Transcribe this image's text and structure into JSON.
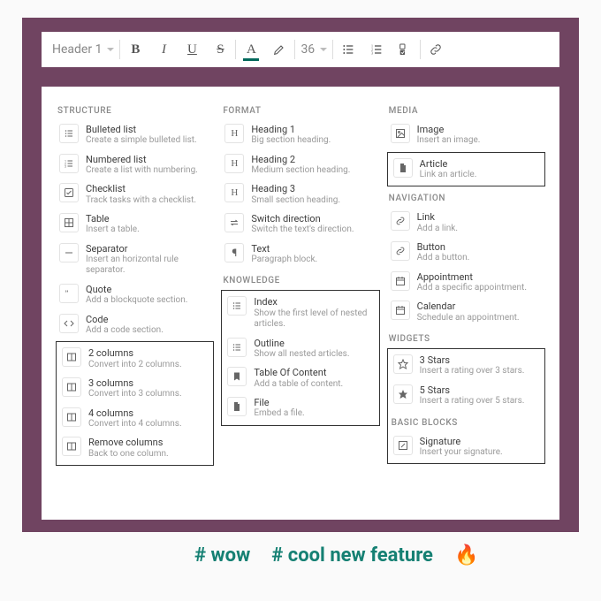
{
  "toolbar": {
    "style_select": "Header 1",
    "bold": "B",
    "italic": "I",
    "underline": "U",
    "strike": "S",
    "fontcolor": "A",
    "fontsize": "36"
  },
  "panel": {
    "columns": [
      {
        "groups": [
          {
            "label": "STRUCTURE",
            "highlight": false,
            "items": [
              {
                "icon": "list-ul",
                "title": "Bulleted list",
                "desc": "Create a simple bulleted list."
              },
              {
                "icon": "list-ol",
                "title": "Numbered list",
                "desc": "Create a list with numbering."
              },
              {
                "icon": "check",
                "title": "Checklist",
                "desc": "Track tasks with a checklist."
              },
              {
                "icon": "table",
                "title": "Table",
                "desc": "Insert a table."
              },
              {
                "icon": "minus",
                "title": "Separator",
                "desc": "Insert an horizontal rule separator."
              },
              {
                "icon": "quote",
                "title": "Quote",
                "desc": "Add a blockquote section."
              },
              {
                "icon": "code",
                "title": "Code",
                "desc": "Add a code section."
              }
            ]
          },
          {
            "label": "",
            "highlight": true,
            "items": [
              {
                "icon": "cols",
                "title": "2 columns",
                "desc": "Convert into 2 columns."
              },
              {
                "icon": "cols",
                "title": "3 columns",
                "desc": "Convert into 3 columns."
              },
              {
                "icon": "cols",
                "title": "4 columns",
                "desc": "Convert into 4 columns."
              },
              {
                "icon": "cols",
                "title": "Remove columns",
                "desc": "Back to one column."
              }
            ]
          }
        ]
      },
      {
        "groups": [
          {
            "label": "FORMAT",
            "highlight": false,
            "items": [
              {
                "icon": "H",
                "title": "Heading 1",
                "desc": "Big section heading."
              },
              {
                "icon": "H",
                "title": "Heading 2",
                "desc": "Medium section heading."
              },
              {
                "icon": "H",
                "title": "Heading 3",
                "desc": "Small section heading."
              },
              {
                "icon": "swap",
                "title": "Switch direction",
                "desc": "Switch the text's direction."
              },
              {
                "icon": "para",
                "title": "Text",
                "desc": "Paragraph block."
              }
            ]
          },
          {
            "label": "KNOWLEDGE",
            "highlight": true,
            "items": [
              {
                "icon": "list-ul",
                "title": "Index",
                "desc": "Show the first level of nested articles."
              },
              {
                "icon": "list-ul",
                "title": "Outline",
                "desc": "Show all nested articles."
              },
              {
                "icon": "bookmark",
                "title": "Table Of Content",
                "desc": "Add a table of content."
              },
              {
                "icon": "file",
                "title": "File",
                "desc": "Embed a file."
              }
            ]
          }
        ]
      },
      {
        "groups": [
          {
            "label": "MEDIA",
            "highlight": false,
            "items": [
              {
                "icon": "image",
                "title": "Image",
                "desc": "Insert an image."
              }
            ]
          },
          {
            "label": "",
            "highlight": true,
            "items": [
              {
                "icon": "file",
                "title": "Article",
                "desc": "Link an article."
              }
            ]
          },
          {
            "label": "NAVIGATION",
            "highlight": false,
            "items": [
              {
                "icon": "link",
                "title": "Link",
                "desc": "Add a link."
              },
              {
                "icon": "link",
                "title": "Button",
                "desc": "Add a button."
              },
              {
                "icon": "cal",
                "title": "Appointment",
                "desc": "Add a specific appointment."
              },
              {
                "icon": "cal",
                "title": "Calendar",
                "desc": "Schedule an appointment."
              }
            ]
          },
          {
            "label": "WIDGETS",
            "highlight": true,
            "items": [
              {
                "icon": "star-o",
                "title": "3 Stars",
                "desc": "Insert a rating over 3 stars."
              },
              {
                "icon": "star",
                "title": "5 Stars",
                "desc": "Insert a rating over 5 stars."
              }
            ],
            "trailing_label": "BASIC BLOCKS",
            "trailing_items": [
              {
                "icon": "edit",
                "title": "Signature",
                "desc": "Insert your signature."
              }
            ]
          }
        ]
      }
    ]
  },
  "tags": {
    "wow": "# wow",
    "feature": "# cool new feature",
    "fire": "🔥"
  }
}
